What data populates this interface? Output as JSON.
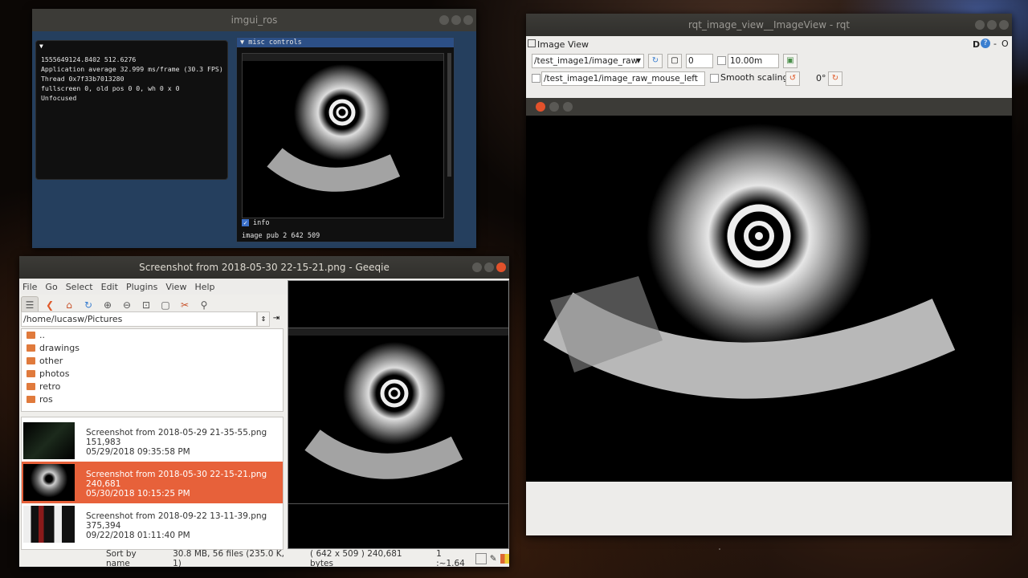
{
  "imgui": {
    "title": "imgui_ros",
    "left_header": "▼",
    "lines": [
      "1555649124.8402 512.6276",
      "Application average 32.999 ms/frame (30.3 FPS)",
      "Thread 0x7f33b7013280",
      "fullscreen 0, old pos 0 0, wh 0 x 0",
      "Unfocused"
    ],
    "misc_header": "▼ misc controls",
    "info_label": "info",
    "info_text": "image pub 2 642 509"
  },
  "geeqie": {
    "title": "Screenshot from 2018-05-30 22-15-21.png - Geeqie",
    "menu": [
      "File",
      "Go",
      "Select",
      "Edit",
      "Plugins",
      "View",
      "Help"
    ],
    "path": "/home/lucasw/Pictures",
    "folders": [
      "..",
      "drawings",
      "other",
      "photos",
      "retro",
      "ros"
    ],
    "files": [
      {
        "name": "Screenshot from 2018-05-29 21-35-55.png",
        "size": "151,983",
        "date": "05/29/2018 09:35:58 PM"
      },
      {
        "name": "Screenshot from 2018-05-30 22-15-21.png",
        "size": "240,681",
        "date": "05/30/2018 10:15:25 PM"
      },
      {
        "name": "Screenshot from 2018-09-22 13-11-39.png",
        "size": "375,394",
        "date": "09/22/2018 01:11:40 PM"
      }
    ],
    "status": {
      "sort": "Sort by name",
      "summary": "30.8 MB, 56 files (235.0 K, 1)",
      "info": "( 642 x 509 ) 240,681 bytes",
      "zoom": "1 :~1.64"
    }
  },
  "rqt": {
    "title": "rqt_image_view__ImageView - rqt",
    "panel_title": "Image View",
    "dock_label": "D",
    "topic": "/test_image1/image_raw",
    "spin_value": "0",
    "max_value": "10.00m",
    "mouse_topic": "/test_image1/image_raw_mouse_left",
    "smooth_label": "Smooth scaling",
    "rotation": "0°"
  }
}
